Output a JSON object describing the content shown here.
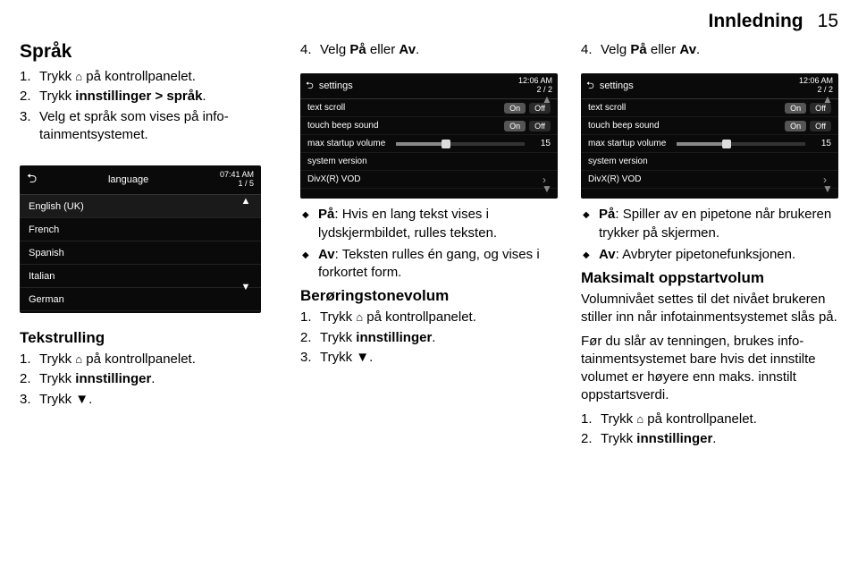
{
  "header": {
    "section": "Innledning",
    "page": "15"
  },
  "col1": {
    "h2": "Språk",
    "steps": [
      {
        "pre": "Trykk ",
        "icon": "⌂",
        "post": " på kontrollpanelet."
      },
      {
        "pre": "Trykk ",
        "bold": "innstillinger > språk",
        "post": "."
      },
      {
        "pre": "Velg et språk som vises på info­tainmentsystemet.",
        "bold": "",
        "post": ""
      }
    ],
    "shot": {
      "back": "⮌",
      "title": "language",
      "time": "07:41 AM",
      "idx": "1 / 5",
      "rows": [
        "English (UK)",
        "French",
        "Spanish",
        "Italian",
        "German"
      ],
      "up": "▲",
      "down": "▼"
    },
    "h3": "Tekstrulling",
    "steps2": [
      {
        "pre": "Trykk ",
        "icon": "⌂",
        "post": " på kontrollpanelet."
      },
      {
        "pre": "Trykk ",
        "bold": "innstillinger",
        "post": "."
      },
      {
        "pre": "Trykk ▼.",
        "bold": "",
        "post": ""
      }
    ]
  },
  "col2": {
    "step4": {
      "pre": "Velg ",
      "bold": "På",
      "mid": " eller ",
      "bold2": "Av",
      "post": "."
    },
    "shot": {
      "back": "⮌",
      "title": "settings",
      "time": "12:06 AM",
      "idx": "2 / 2",
      "rows": [
        {
          "label": "text scroll",
          "on": "On",
          "off": "Off"
        },
        {
          "label": "touch beep sound",
          "on": "On",
          "off": "Off"
        },
        {
          "label": "max startup volume",
          "val": "15"
        },
        {
          "label": "system version"
        },
        {
          "label": "DivX(R) VOD"
        }
      ],
      "up": "▲",
      "down": "▼",
      "right": "›"
    },
    "ul": [
      {
        "bold": "På",
        "text": ": Hvis en lang tekst vises i lydskjermbildet, rulles teksten."
      },
      {
        "bold": "Av",
        "text": ": Teksten rulles én gang, og vises i forkortet form."
      }
    ],
    "h3": "Berøringstonevolum",
    "steps": [
      {
        "pre": "Trykk ",
        "icon": "⌂",
        "post": " på kontrollpanelet."
      },
      {
        "pre": "Trykk ",
        "bold": "innstillinger",
        "post": "."
      },
      {
        "pre": "Trykk ▼.",
        "bold": "",
        "post": ""
      }
    ]
  },
  "col3": {
    "step4": {
      "pre": "Velg ",
      "bold": "På",
      "mid": " eller ",
      "bold2": "Av",
      "post": "."
    },
    "ul": [
      {
        "bold": "På",
        "text": ": Spiller av en pipetone når brukeren trykker på skjermen."
      },
      {
        "bold": "Av",
        "text": ": Avbryter pipetonefunksjo­nen."
      }
    ],
    "h3": "Maksimalt oppstartvolum",
    "p1": "Volumnivået settes til det nivået bru­keren stiller inn når infotainmentsys­temet slås på.",
    "p2": "Før du slår av tenningen, brukes info­tainmentsystemet bare hvis det inn­stilte volumet er høyere enn maks. innstilt oppstartsverdi.",
    "steps": [
      {
        "pre": "Trykk ",
        "icon": "⌂",
        "post": " på kontrollpanelet."
      },
      {
        "pre": "Trykk ",
        "bold": "innstillinger",
        "post": "."
      }
    ]
  }
}
